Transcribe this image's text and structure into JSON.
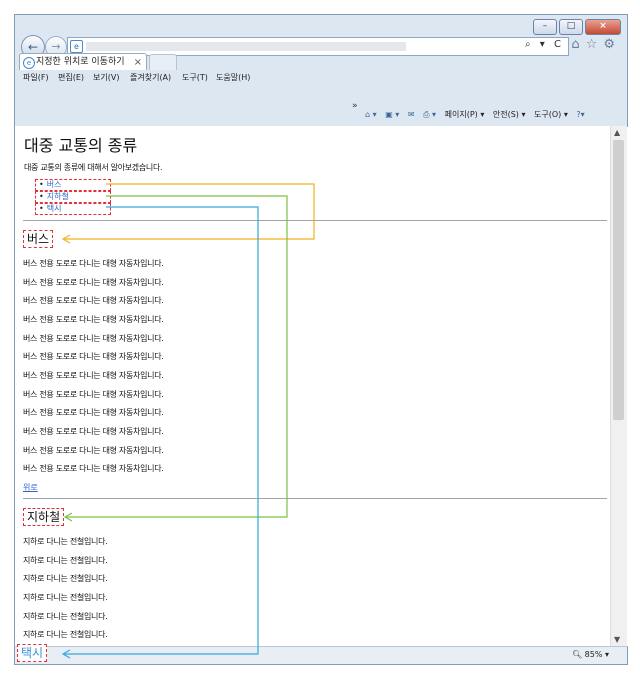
{
  "browser": {
    "tab_title": "지정한 위치로 이동하기",
    "tab_close": "×",
    "menu": [
      "파일(F)",
      "편집(E)",
      "보기(V)",
      "즐겨찾기(A)",
      "도구(T)",
      "도움말(H)"
    ],
    "command_bar": [
      "페이지(P) ▾",
      "안전(S) ▾",
      "도구(O) ▾"
    ],
    "chevron": "»",
    "address_controls": "⌕ ▾ C",
    "zoom": "85%",
    "zoom_arrow": "▾"
  },
  "page": {
    "title": "대중 교통의 종류",
    "intro": "대중 교통의 종류에 대해서 알아보겠습니다.",
    "toc": [
      "버스",
      "지하철",
      "택시"
    ],
    "bus": {
      "heading": "버스",
      "lines": [
        "버스 전용 도로로 다니는 대형 자동차입니다.",
        "버스 전용 도로로 다니는 대형 자동차입니다.",
        "버스 전용 도로로 다니는 대형 자동차입니다.",
        "버스 전용 도로로 다니는 대형 자동차입니다.",
        "버스 전용 도로로 다니는 대형 자동차입니다.",
        "버스 전용 도로로 다니는 대형 자동차입니다.",
        "버스 전용 도로로 다니는 대형 자동차입니다.",
        "버스 전용 도로로 다니는 대형 자동차입니다.",
        "버스 전용 도로로 다니는 대형 자동차입니다.",
        "버스 전용 도로로 다니는 대형 자동차입니다.",
        "버스 전용 도로로 다니는 대형 자동차입니다.",
        "버스 전용 도로로 다니는 대형 자동차입니다."
      ],
      "top_link": "위로"
    },
    "subway": {
      "heading": "지하철",
      "lines": [
        "지하로 다니는 전철입니다.",
        "지하로 다니는 전철입니다.",
        "지하로 다니는 전철입니다.",
        "지하로 다니는 전철입니다.",
        "지하로 다니는 전철입니다.",
        "지하로 다니는 전철입니다."
      ]
    },
    "taxi": {
      "heading": "택시"
    }
  },
  "colors": {
    "annotation_box": "#e3313c",
    "arrow_bus": "#f2b21c",
    "arrow_subway": "#7dc243",
    "arrow_taxi": "#36a7dd",
    "link": "#2f66c8"
  }
}
